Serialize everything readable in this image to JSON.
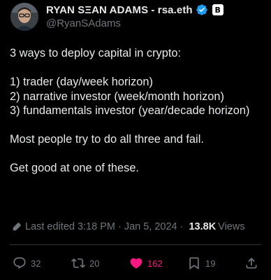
{
  "author": {
    "name": "RYAN SΞAN ADAMS - rsa.eth",
    "handle": "@RyanSAdams",
    "badge_letter": "B"
  },
  "tweet": {
    "lines": [
      "3 ways to deploy capital in crypto:",
      "",
      "1) trader (day/week horizon)",
      "2) narrative investor (week/month horizon)",
      "3) fundamentals investor (year/decade horizon)",
      "",
      "Most people try to do all three and fail.",
      "",
      "Get good at one of these."
    ]
  },
  "meta": {
    "edited": "Last edited 3:18 PM",
    "sep1": "·",
    "date": "Jan 5, 2024",
    "sep2": "·",
    "views_count": "13.8K",
    "views_label": "Views"
  },
  "actions": {
    "replies": "32",
    "reposts": "20",
    "likes": "162",
    "bookmarks": "19"
  },
  "colors": {
    "background": "#000000",
    "text": "#e7e9ea",
    "muted": "#71767b",
    "verified": "#1d9bf0",
    "like": "#f91880",
    "divider": "#2f3336"
  },
  "icons": {
    "avatar": "profile-photo",
    "verified": "verified-badge-icon",
    "affiliate": "affiliate-badge-icon",
    "more": "more-dots-icon",
    "edit": "pencil-icon",
    "reply": "reply-bubble-icon",
    "repost": "repost-arrows-icon",
    "like": "heart-filled-icon",
    "bookmark": "bookmark-icon",
    "share": "share-upload-icon"
  }
}
